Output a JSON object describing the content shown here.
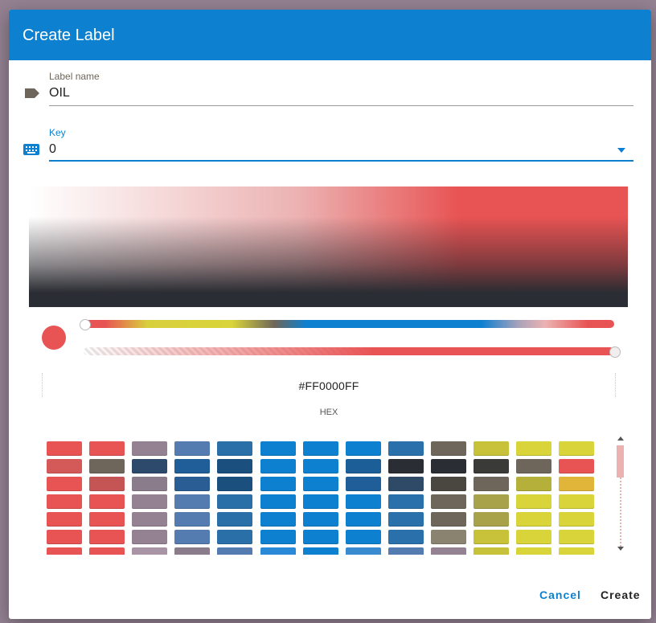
{
  "dialog": {
    "title": "Create Label"
  },
  "fields": {
    "label_name": {
      "label": "Label name",
      "value": "OIL",
      "icon": "label-tag-icon"
    },
    "key": {
      "label": "Key",
      "value": "0",
      "icon": "keyboard-icon"
    }
  },
  "color_picker": {
    "hex_value": "#FF0000FF",
    "hex_caption": "HEX",
    "current_color": "#e85353"
  },
  "palette": {
    "rows": [
      [
        "#e85353",
        "#e85353",
        "#948293",
        "#547cb0",
        "#2b6fa8",
        "#0d80d0",
        "#0d80d0",
        "#0d80d0",
        "#2a70aa",
        "#6e665a",
        "#c8c23a",
        "#d8d43a",
        "#d8d43a"
      ],
      [
        "#d45a5a",
        "#6e665a",
        "#2d4a6c",
        "#1f5e98",
        "#1b4f7e",
        "#0d80d0",
        "#0d80d0",
        "#1c5e98",
        "#2a2d33",
        "#2a2d33",
        "#3a3a38",
        "#6e665a",
        "#e85353"
      ],
      [
        "#e85353",
        "#c55555",
        "#8a7c8b",
        "#2a5d94",
        "#1b4f7e",
        "#0d80d0",
        "#0d80d0",
        "#1f5e98",
        "#2f4a66",
        "#4a4640",
        "#6e665a",
        "#b5b03a",
        "#e0b53a"
      ],
      [
        "#e85353",
        "#e85353",
        "#948293",
        "#547cb0",
        "#2b6fa8",
        "#0d80d0",
        "#0d80d0",
        "#0d80d0",
        "#2a70aa",
        "#6e665a",
        "#a8a34a",
        "#d8d43a",
        "#d8d43a"
      ],
      [
        "#e85353",
        "#e85353",
        "#948293",
        "#547cb0",
        "#2b6fa8",
        "#0d80d0",
        "#0d80d0",
        "#0d80d0",
        "#2a70aa",
        "#6e665a",
        "#a8a34a",
        "#d8d43a",
        "#d8d43a"
      ],
      [
        "#e85353",
        "#e85353",
        "#948293",
        "#547cb0",
        "#2b6fa8",
        "#0d80d0",
        "#0d80d0",
        "#0d80d0",
        "#2a70aa",
        "#8a8370",
        "#c8c23a",
        "#d8d43a",
        "#d8d43a"
      ],
      [
        "#e85353",
        "#e85353",
        "#a894a4",
        "#8a7c8b",
        "#547cb0",
        "#2b8ad8",
        "#0d80d0",
        "#3a8ad0",
        "#547cb0",
        "#948293",
        "#c8c23a",
        "#d8d43a",
        "#d8d43a"
      ]
    ]
  },
  "buttons": {
    "cancel": "Cancel",
    "create": "Create"
  },
  "colors": {
    "primary": "#0d80d0",
    "backdrop": "#948293",
    "icon_brown": "#6e665a"
  }
}
